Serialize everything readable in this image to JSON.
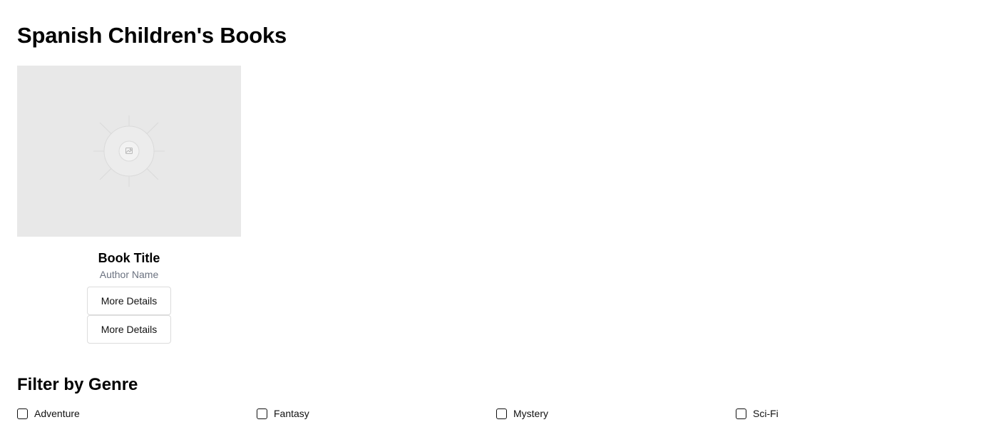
{
  "page": {
    "title": "Spanish Children's Books"
  },
  "book": {
    "title": "Book Title",
    "author": "Author Name",
    "image_icon": "image-placeholder-icon",
    "buttons": [
      "More Details",
      "More Details"
    ]
  },
  "filter": {
    "heading": "Filter by Genre",
    "genres": [
      {
        "label": "Adventure",
        "checked": false
      },
      {
        "label": "Fantasy",
        "checked": false
      },
      {
        "label": "Mystery",
        "checked": false
      },
      {
        "label": "Sci-Fi",
        "checked": false
      }
    ]
  },
  "colors": {
    "image_placeholder_bg": "#e8e8e8",
    "author_text": "#6b7280",
    "button_border": "#dcdcdc"
  }
}
